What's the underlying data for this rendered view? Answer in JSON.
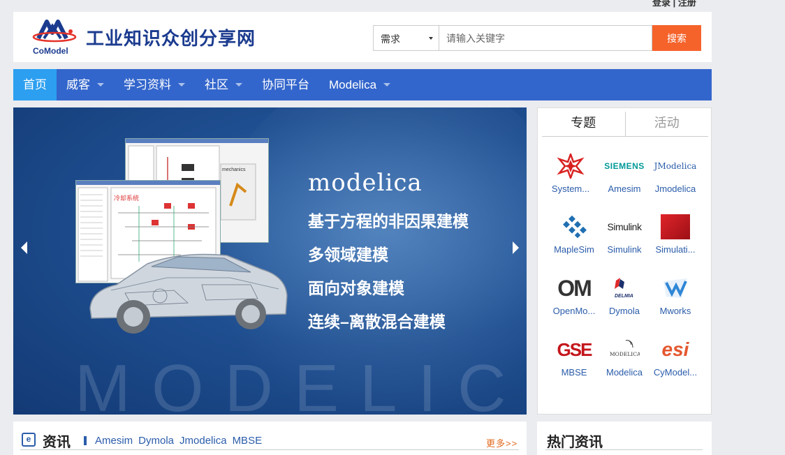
{
  "topbar": {
    "login": "登录",
    "sep": "|",
    "register": "注册"
  },
  "header": {
    "logo_text": "CoModel",
    "site_title": "工业知识众创分享网"
  },
  "search": {
    "category": "需求",
    "placeholder": "请输入关键字",
    "button": "搜索"
  },
  "nav": {
    "items": [
      {
        "label": "首页",
        "dropdown": false,
        "active": true
      },
      {
        "label": "威客",
        "dropdown": true
      },
      {
        "label": "学习资料",
        "dropdown": true
      },
      {
        "label": "社区",
        "dropdown": true
      },
      {
        "label": "协同平台",
        "dropdown": false
      },
      {
        "label": "Modelica",
        "dropdown": true
      }
    ]
  },
  "banner": {
    "title": "modelica",
    "lines": [
      "基于方程的非因果建模",
      "多领域建模",
      "面向对象建模",
      "连续–离散混合建模"
    ],
    "watermark": "MODELICA",
    "screen_label": "mechanics"
  },
  "side": {
    "tabs": [
      "专题",
      "活动"
    ],
    "topics": [
      {
        "label": "System...",
        "icon": "wolfram-star-icon",
        "color": "#d92121"
      },
      {
        "label": "Amesim",
        "icon": "siemens-logo-icon",
        "logo": "SIEMENS",
        "color": "#009999"
      },
      {
        "label": "Jmodelica",
        "icon": "jmodelica-logo-icon",
        "logo": "JModelica",
        "color": "#2a5caa"
      },
      {
        "label": "MapleSim",
        "icon": "maplesim-icon",
        "color": "#1f6fb2"
      },
      {
        "label": "Simulink",
        "icon": "simulink-logo-icon",
        "logo": "Simulink",
        "color": "#222222"
      },
      {
        "label": "Simulati...",
        "icon": "simulation-red-icon",
        "color": "#c4161c"
      },
      {
        "label": "OpenMo...",
        "icon": "openmodelica-icon",
        "logo": "OM",
        "color": "#333333"
      },
      {
        "label": "Dymola",
        "icon": "dymola-delmia-icon",
        "logo": "DELMIA",
        "color": "#1b2f6b"
      },
      {
        "label": "Mworks",
        "icon": "mworks-icon",
        "color": "#2f86d6"
      },
      {
        "label": "MBSE",
        "icon": "mbse-gse-icon",
        "logo": "GSE",
        "color": "#c4161c"
      },
      {
        "label": "Modelica",
        "icon": "modelica-logo-icon",
        "logo": "MODELICA",
        "color": "#333333"
      },
      {
        "label": "CyModel...",
        "icon": "esi-logo-icon",
        "logo": "esi",
        "color": "#e4572e"
      }
    ]
  },
  "news": {
    "title": "资讯",
    "tags": [
      "Amesim",
      "Dymola",
      "Jmodelica",
      "MBSE"
    ],
    "more": "更多>>",
    "icon_letter": "e"
  },
  "hot": {
    "title": "热门资讯"
  }
}
